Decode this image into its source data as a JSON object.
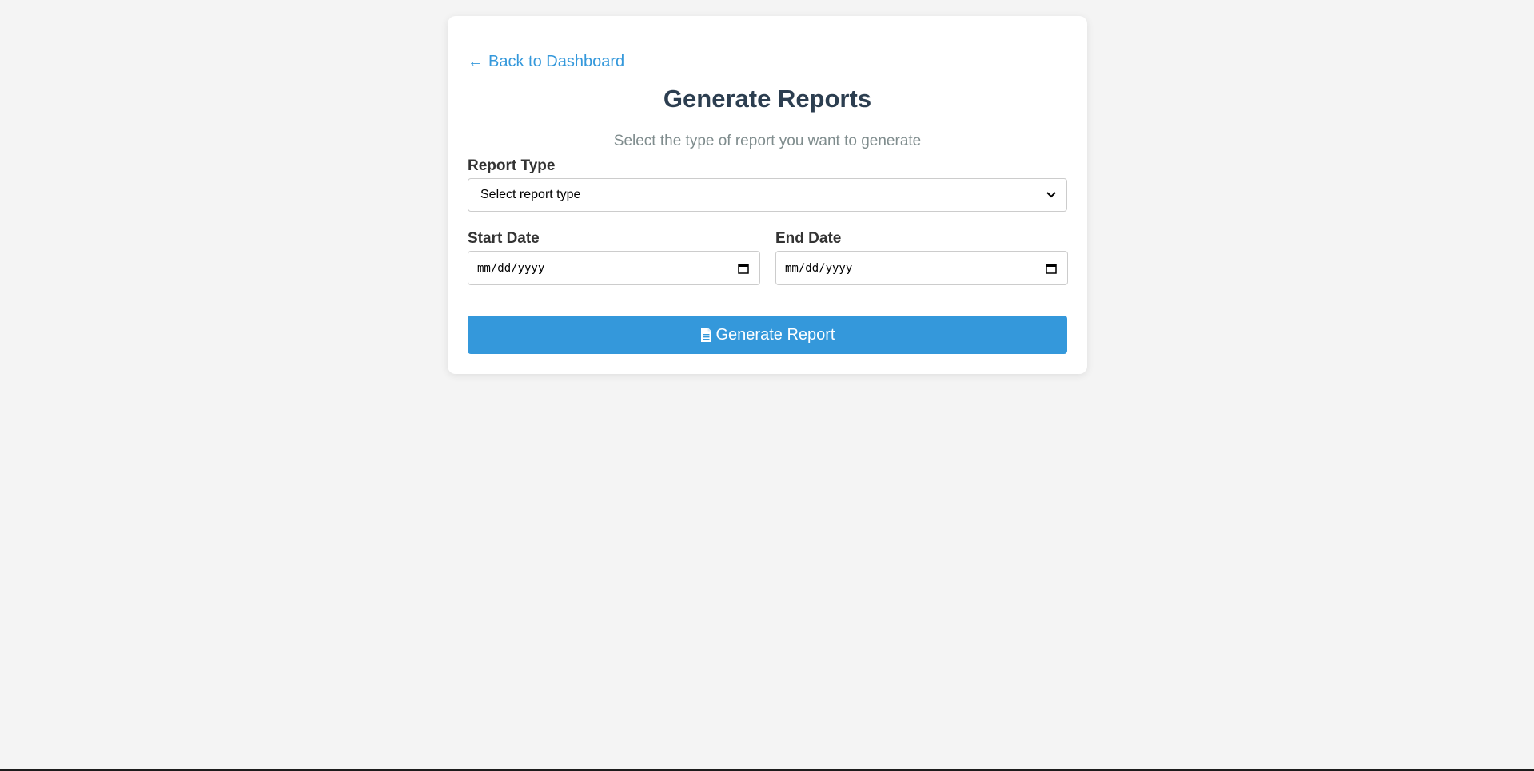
{
  "nav": {
    "back_arrow": "←",
    "back_label": "Back to Dashboard"
  },
  "header": {
    "title": "Generate Reports",
    "subtitle": "Select the type of report you want to generate"
  },
  "form": {
    "report_type": {
      "label": "Report Type",
      "selected": "Select report type"
    },
    "start_date": {
      "label": "Start Date",
      "placeholder": "mm/dd/yyyy"
    },
    "end_date": {
      "label": "End Date",
      "placeholder": "mm/dd/yyyy"
    },
    "submit_label": "Generate Report"
  },
  "icons": {
    "back": "arrow-left-icon",
    "select": "chevron-down-icon",
    "date": "calendar-icon",
    "submit": "file-document-icon"
  },
  "colors": {
    "accent": "#3498db",
    "title": "#2c3e50",
    "subtitle": "#7f8c8d",
    "background": "#f4f4f4",
    "card": "#ffffff"
  }
}
